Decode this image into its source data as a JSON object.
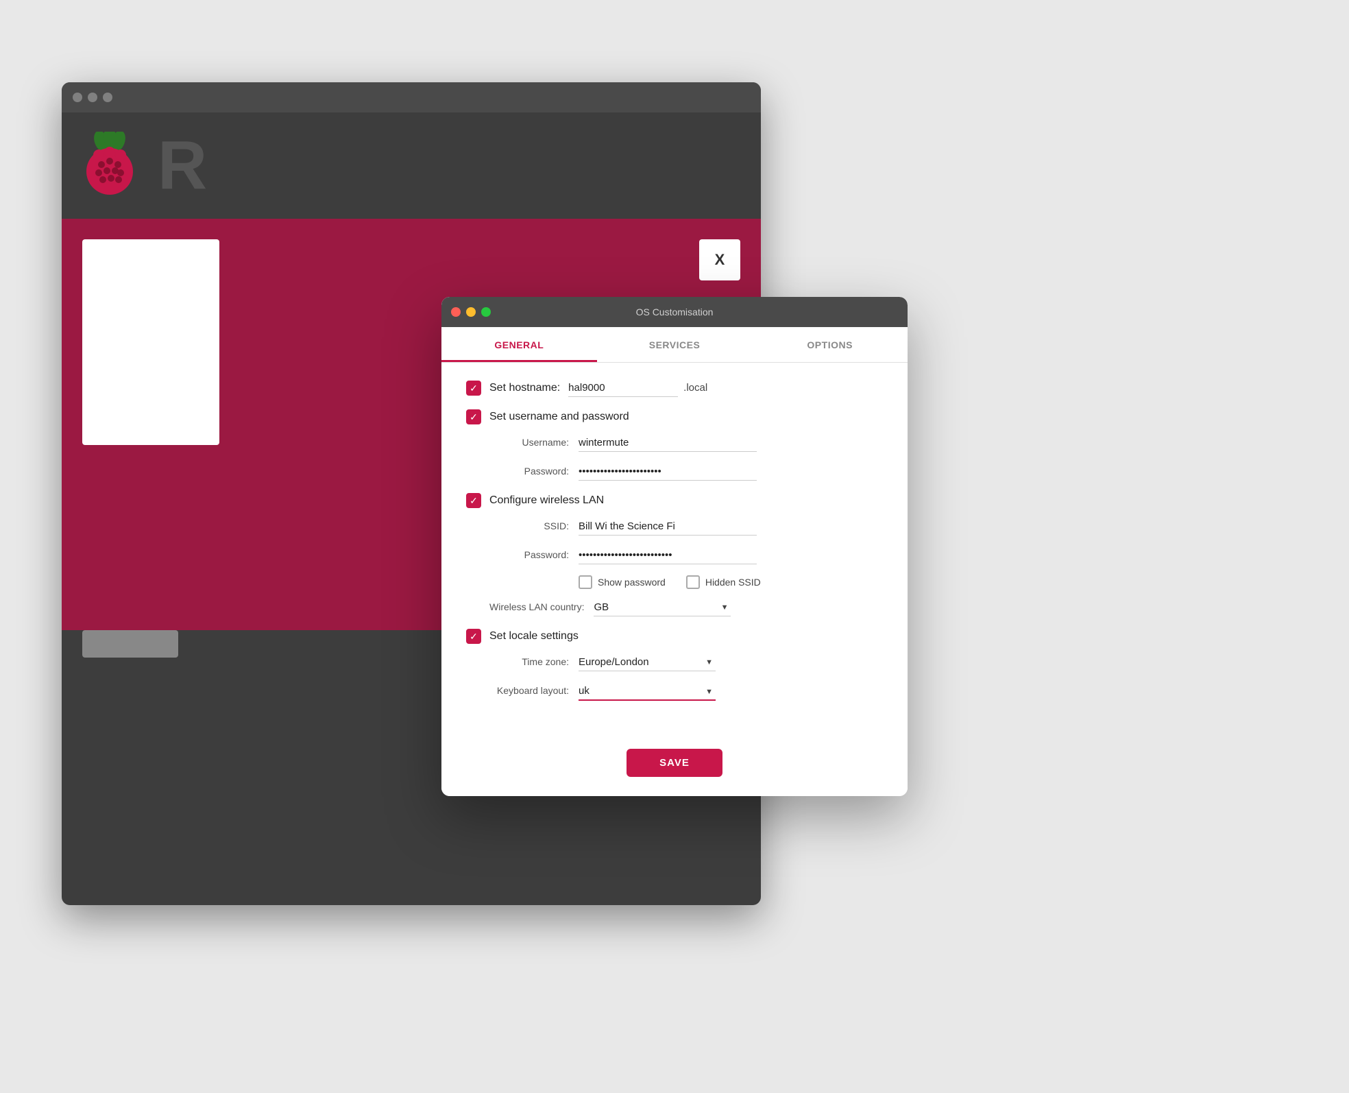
{
  "titlebar": {
    "title": "OS Customisation",
    "dots": [
      "red",
      "yellow",
      "green"
    ]
  },
  "tabs": [
    {
      "id": "general",
      "label": "GENERAL",
      "active": true
    },
    {
      "id": "services",
      "label": "SERVICES",
      "active": false
    },
    {
      "id": "options",
      "label": "OPTIONS",
      "active": false
    }
  ],
  "form": {
    "hostname": {
      "checkbox_checked": true,
      "label": "Set hostname:",
      "value": "hal9000",
      "suffix": ".local"
    },
    "user_password": {
      "checkbox_checked": true,
      "label": "Set username and password",
      "username_label": "Username:",
      "username_value": "wintermute",
      "password_label": "Password:",
      "password_value": "••••••••••••••••••••••••••••••••••••"
    },
    "wireless_lan": {
      "checkbox_checked": true,
      "label": "Configure wireless LAN",
      "ssid_label": "SSID:",
      "ssid_value": "Bill Wi the Science Fi",
      "password_label": "Password:",
      "password_value": "••••••••••••••••••••••••••••••••••••",
      "show_password_label": "Show password",
      "show_password_checked": false,
      "hidden_ssid_label": "Hidden SSID",
      "hidden_ssid_checked": false,
      "country_label": "Wireless LAN country:",
      "country_value": "GB"
    },
    "locale": {
      "checkbox_checked": true,
      "label": "Set locale settings",
      "timezone_label": "Time zone:",
      "timezone_value": "Europe/London",
      "keyboard_label": "Keyboard layout:",
      "keyboard_value": "uk"
    }
  },
  "save_button": "SAVE",
  "bg": {
    "x_label": "X"
  }
}
